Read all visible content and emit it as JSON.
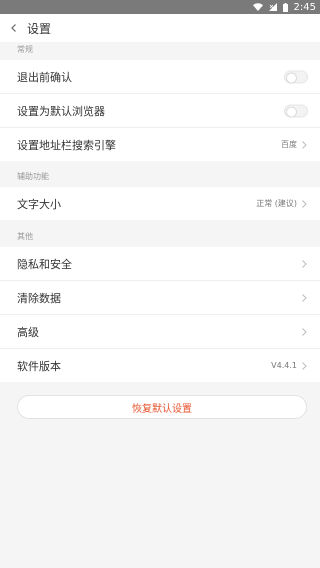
{
  "status_bar": {
    "time": "2:45"
  },
  "header": {
    "title": "设置"
  },
  "sections": {
    "general": {
      "title": "常规",
      "items": [
        {
          "label": "退出前确认",
          "toggle": false
        },
        {
          "label": "设置为默认浏览器",
          "toggle": false
        },
        {
          "label": "设置地址栏搜索引擎",
          "value": "百度"
        }
      ]
    },
    "accessibility": {
      "title": "辅助功能",
      "items": [
        {
          "label": "文字大小",
          "value": "正常 (建议)"
        }
      ]
    },
    "other": {
      "title": "其他",
      "items": [
        {
          "label": "隐私和安全"
        },
        {
          "label": "清除数据"
        },
        {
          "label": "高级"
        },
        {
          "label": "软件版本",
          "value": "V4.4.1"
        }
      ]
    }
  },
  "reset_button": {
    "label": "恢复默认设置"
  },
  "colors": {
    "accent": "#e8542f",
    "background": "#f5f5f5",
    "statusbar": "#7a7a7a"
  }
}
